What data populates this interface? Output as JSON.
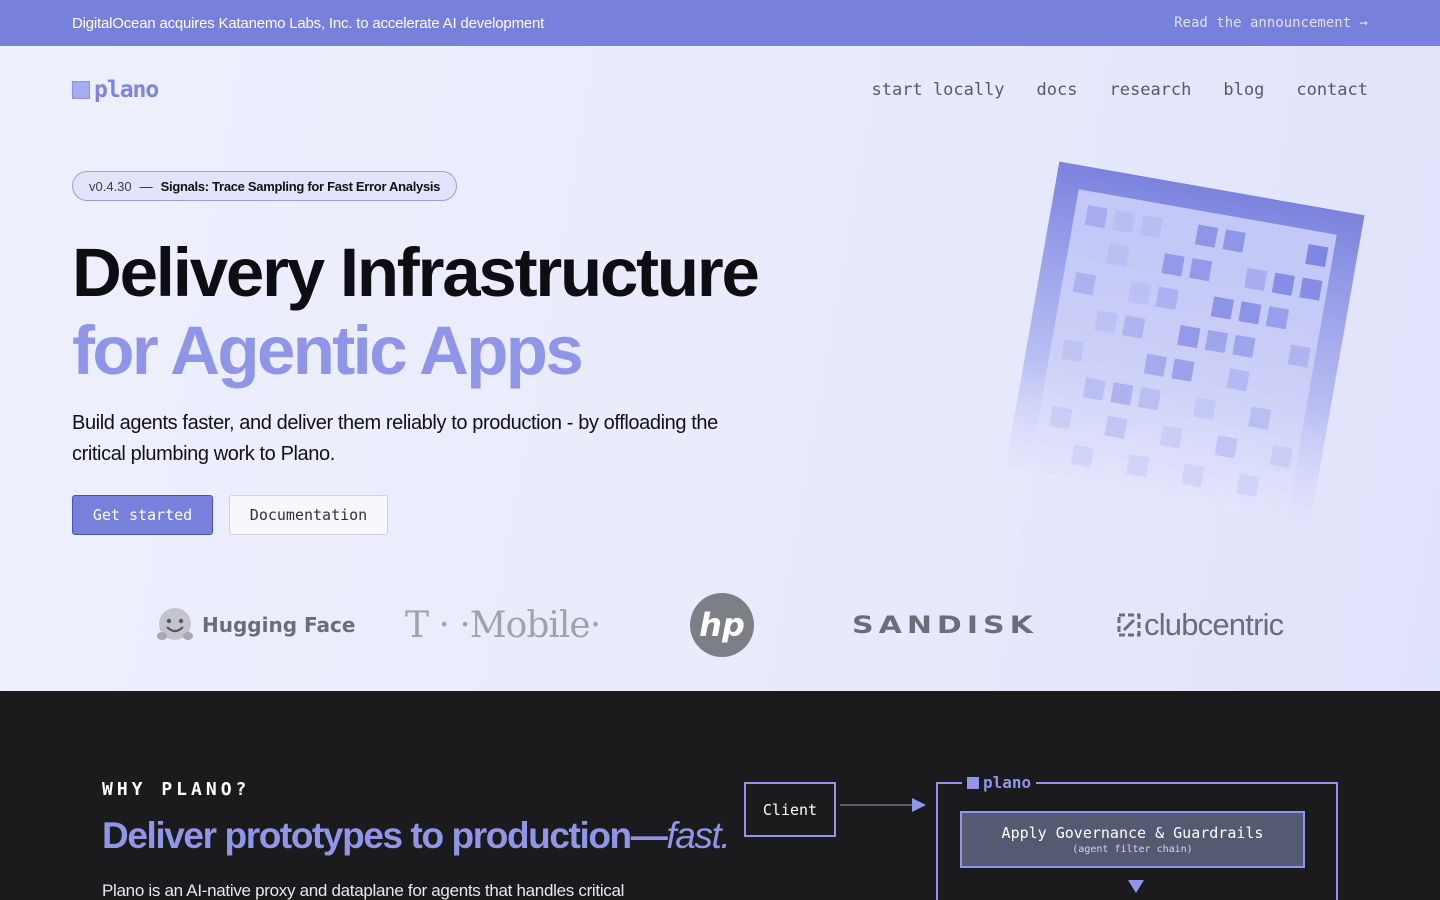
{
  "banner": {
    "text": "DigitalOcean acquires Katanemo Labs, Inc. to accelerate AI development",
    "link": "Read the announcement →"
  },
  "nav": {
    "logo_text": "plano",
    "links": [
      "start locally",
      "docs",
      "research",
      "blog",
      "contact"
    ]
  },
  "hero": {
    "version": "v0.4.30",
    "version_dash": "—",
    "version_title": "Signals: Trace Sampling for Fast Error Analysis",
    "headline_line1": "Delivery Infrastructure",
    "headline_line2": "for Agentic Apps",
    "subtitle": "Build agents faster, and deliver them reliably to production - by offloading the critical plumbing work to Plano.",
    "primary_button": "Get started",
    "secondary_button": "Documentation"
  },
  "logos": {
    "hugging_face": "Hugging Face",
    "tmobile": "T · ·Mobile·",
    "hp": "hp",
    "sandisk": "SANDISK",
    "clubcentric": "clubcentric"
  },
  "why": {
    "label": "WHY PLANO?",
    "headline": "Deliver prototypes to production—",
    "headline_em": "fast.",
    "body": "Plano is an AI-native proxy and dataplane for agents that handles critical"
  },
  "diagram": {
    "client": "Client",
    "plano_label": "plano",
    "governance_title": "Apply Governance & Guardrails",
    "governance_sub": "(agent filter chain)"
  },
  "colors": {
    "accent": "#7780db",
    "accent_light": "#9096e7",
    "dark_bg": "#1b1b1d"
  }
}
